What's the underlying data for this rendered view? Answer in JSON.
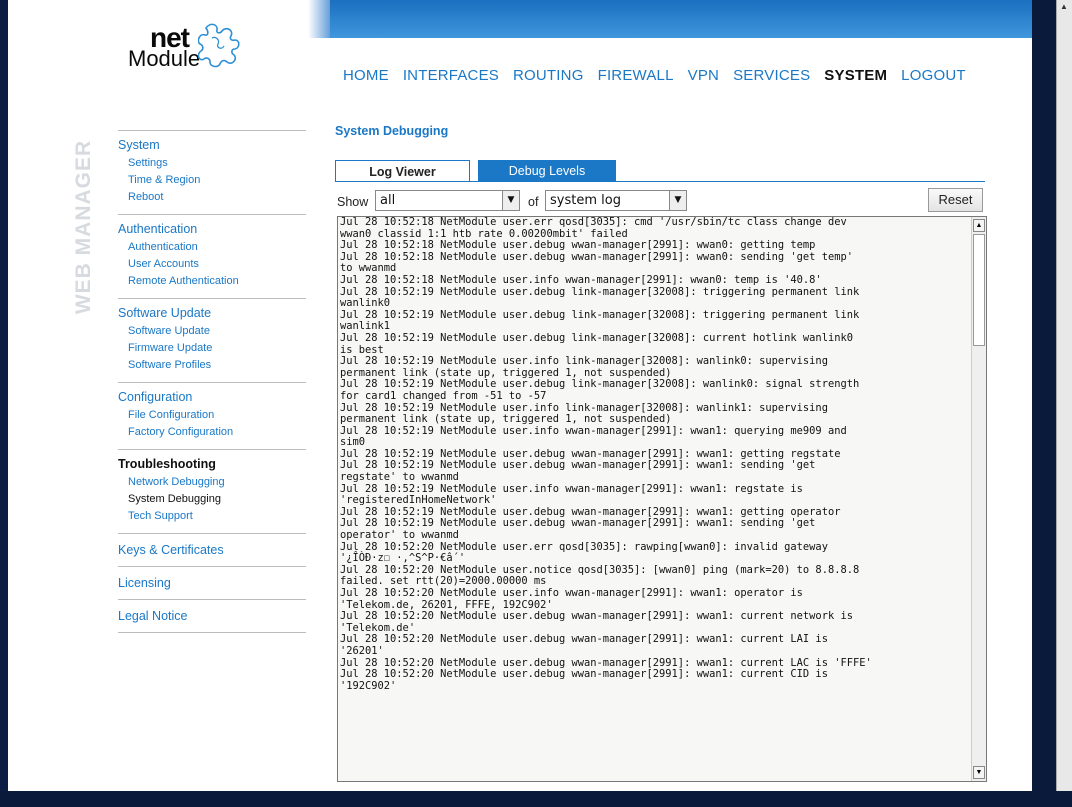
{
  "logo": {
    "net": "net",
    "module": "Module"
  },
  "vertical_label": "WEB MANAGER",
  "topnav": [
    {
      "label": "HOME",
      "active": false
    },
    {
      "label": "INTERFACES",
      "active": false
    },
    {
      "label": "ROUTING",
      "active": false
    },
    {
      "label": "FIREWALL",
      "active": false
    },
    {
      "label": "VPN",
      "active": false
    },
    {
      "label": "SERVICES",
      "active": false
    },
    {
      "label": "SYSTEM",
      "active": true
    },
    {
      "label": "LOGOUT",
      "active": false
    }
  ],
  "sidebar": {
    "system": {
      "label": "System",
      "items": [
        "Settings",
        "Time & Region",
        "Reboot"
      ]
    },
    "authentication": {
      "label": "Authentication",
      "items": [
        "Authentication",
        "User Accounts",
        "Remote Authentication"
      ]
    },
    "software_update": {
      "label": "Software Update",
      "items": [
        "Software Update",
        "Firmware Update",
        "Software Profiles"
      ]
    },
    "configuration": {
      "label": "Configuration",
      "items": [
        "File Configuration",
        "Factory Configuration"
      ]
    },
    "troubleshooting": {
      "label": "Troubleshooting",
      "items": [
        "Network Debugging",
        "System Debugging",
        "Tech Support"
      ]
    },
    "keys": {
      "label": "Keys & Certificates"
    },
    "licensing": {
      "label": "Licensing"
    },
    "legal": {
      "label": "Legal Notice"
    }
  },
  "content": {
    "title": "System Debugging",
    "tabs": [
      "Log Viewer",
      "Debug Levels"
    ],
    "show_label": "Show",
    "show_value": "all",
    "of_label": "of",
    "source_value": "system log",
    "reset_label": "Reset"
  },
  "log_lines": [
    "Jul 28 10:52:18 NetModule user.err qosd[3035]: cmd '/usr/sbin/tc class change dev",
    "wwan0 classid 1:1 htb rate 0.00200mbit' failed",
    "Jul 28 10:52:18 NetModule user.debug wwan-manager[2991]: wwan0: getting temp",
    "Jul 28 10:52:18 NetModule user.debug wwan-manager[2991]: wwan0: sending 'get temp'",
    "to wwanmd",
    "Jul 28 10:52:18 NetModule user.info wwan-manager[2991]: wwan0: temp is '40.8'",
    "Jul 28 10:52:19 NetModule user.debug link-manager[32008]: triggering permanent link",
    "wanlink0",
    "Jul 28 10:52:19 NetModule user.debug link-manager[32008]: triggering permanent link",
    "wanlink1",
    "Jul 28 10:52:19 NetModule user.debug link-manager[32008]: current hotlink wanlink0",
    "is best",
    "Jul 28 10:52:19 NetModule user.info link-manager[32008]: wanlink0: supervising",
    "permanent link (state up, triggered 1, not suspended)",
    "Jul 28 10:52:19 NetModule user.debug link-manager[32008]: wanlink0: signal strength",
    "for card1 changed from -51 to -57",
    "Jul 28 10:52:19 NetModule user.info link-manager[32008]: wanlink1: supervising",
    "permanent link (state up, triggered 1, not suspended)",
    "Jul 28 10:52:19 NetModule user.info wwan-manager[2991]: wwan1: querying me909 and",
    "sim0",
    "Jul 28 10:52:19 NetModule user.debug wwan-manager[2991]: wwan1: getting regstate",
    "Jul 28 10:52:19 NetModule user.debug wwan-manager[2991]: wwan1: sending 'get",
    "regstate' to wwanmd",
    "Jul 28 10:52:19 NetModule user.info wwan-manager[2991]: wwan1: regstate is",
    "'registeredInHomeNetwork'",
    "Jul 28 10:52:19 NetModule user.debug wwan-manager[2991]: wwan1: getting operator",
    "Jul 28 10:52:19 NetModule user.debug wwan-manager[2991]: wwan1: sending 'get",
    "operator' to wwanmd",
    "Jul 28 10:52:20 NetModule user.err qosd[3035]: rawping[wwan0]: invalid gateway",
    "'¿ÎÒÐ·z☐ ·,^S^P·€â´'",
    "Jul 28 10:52:20 NetModule user.notice qosd[3035]: [wwan0] ping (mark=20) to 8.8.8.8",
    "failed. set rtt(20)=2000.00000 ms",
    "Jul 28 10:52:20 NetModule user.info wwan-manager[2991]: wwan1: operator is",
    "'Telekom.de, 26201, FFFE, 192C902'",
    "Jul 28 10:52:20 NetModule user.debug wwan-manager[2991]: wwan1: current network is",
    "'Telekom.de'",
    "Jul 28 10:52:20 NetModule user.debug wwan-manager[2991]: wwan1: current LAI is",
    "'26201'",
    "Jul 28 10:52:20 NetModule user.debug wwan-manager[2991]: wwan1: current LAC is 'FFFE'",
    "Jul 28 10:52:20 NetModule user.debug wwan-manager[2991]: wwan1: current CID is",
    "'192C902'"
  ],
  "colors": {
    "accent": "#1a78c6",
    "header_blue": "#3f97dd",
    "frame": "#0a1a3a"
  }
}
